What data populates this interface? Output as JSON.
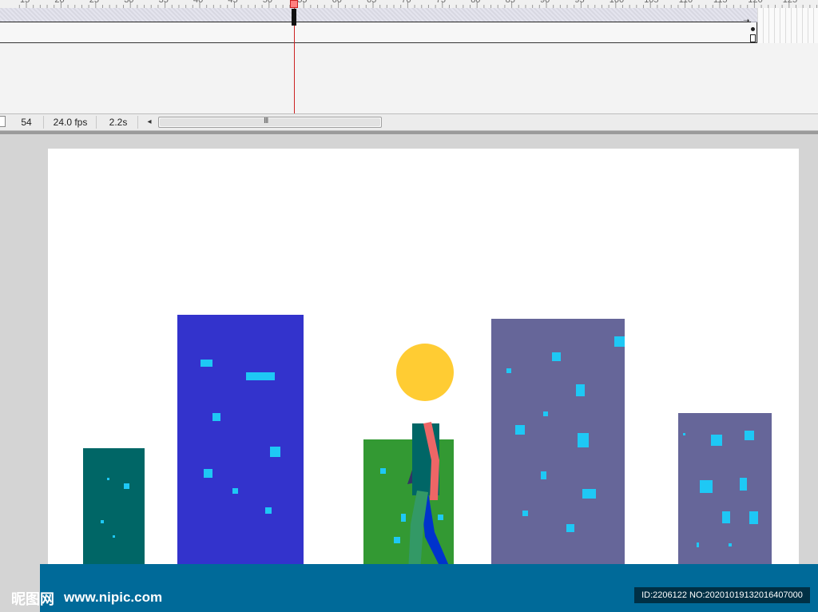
{
  "status": {
    "frame": "54",
    "fps": "24.0 fps",
    "time": "2.2s",
    "scroll_grip": "III"
  },
  "ruler": {
    "labels": [
      "15",
      "20",
      "25",
      "30",
      "35",
      "40",
      "45",
      "50",
      "55",
      "60",
      "65",
      "70",
      "75",
      "80",
      "85",
      "90",
      "95",
      "100",
      "105",
      "110",
      "115",
      "120",
      "125"
    ]
  },
  "watermark": {
    "logo": "昵图网",
    "site": "www.nipic.com",
    "id": "ID:2206122 NO:20201019132016407000"
  },
  "colors": {
    "building_teal": "#006666",
    "building_blue": "#3333cc",
    "building_green": "#339933",
    "building_slate": "#666699",
    "window_cyan": "#1ec8f5",
    "ground": "#006a99",
    "head": "#ffcc33",
    "torso": "#006666",
    "arm_front": "#ee6666",
    "leg_front": "#339966",
    "leg_back": "#0033cc",
    "playhead": "#cc2222"
  }
}
